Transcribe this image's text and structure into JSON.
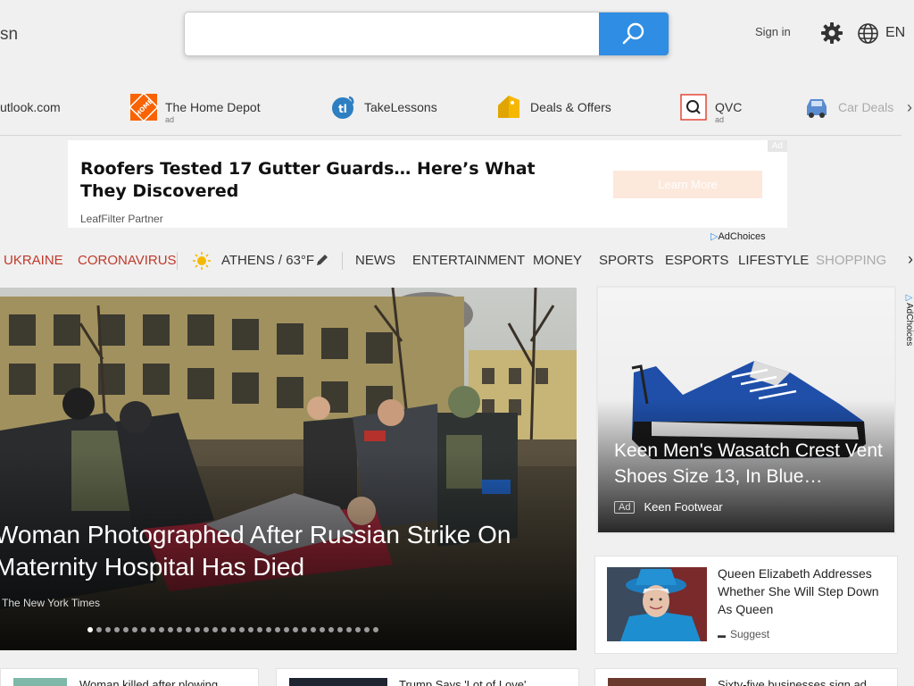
{
  "header": {
    "logo": "sn",
    "search_placeholder": "",
    "sign_in": "Sign in",
    "language": "EN"
  },
  "quicklinks": {
    "items": [
      {
        "label": "utlook.com",
        "ad": ""
      },
      {
        "label": "The Home Depot",
        "ad": "ad"
      },
      {
        "label": "TakeLessons",
        "ad": ""
      },
      {
        "label": "Deals & Offers",
        "ad": ""
      },
      {
        "label": "QVC",
        "ad": "ad"
      },
      {
        "label": "Car Deals",
        "ad": ""
      }
    ]
  },
  "banner": {
    "headline": "Roofers Tested 17 Gutter Guards… Here’s What They Discovered",
    "sponsor": "LeafFilter Partner",
    "cta": "Learn More",
    "ad_tag": "Ad",
    "adchoices": "AdChoices"
  },
  "nav": {
    "ukraine": "UKRAINE",
    "coronavirus": "CORONAVIRUS",
    "weather": "ATHENS / 63°F",
    "items": [
      "NEWS",
      "ENTERTAINMENT",
      "MONEY",
      "SPORTS",
      "ESPORTS",
      "LIFESTYLE",
      "SHOPPING"
    ]
  },
  "hero": {
    "title": "Woman Photographed After Russian Strike On Maternity Hospital Has Died",
    "source": "The New York Times",
    "slide_count": 33,
    "active_slide": 1
  },
  "ad_card": {
    "title": "Keen Men's Wasatch Crest Vent Shoes Size 13, In Blue…",
    "badge": "Ad",
    "brand": "Keen Footwear",
    "adchoices": "AdChoices"
  },
  "queen_card": {
    "title": "Queen Elizabeth Addresses Whether She Will Step Down As Queen",
    "source": "Suggest"
  },
  "bottom_row": {
    "items": [
      {
        "text": "Woman killed after plowing"
      },
      {
        "text": "Trump Says 'Lot of Love'"
      },
      {
        "text": "Sixty-five businesses sign ad"
      }
    ]
  },
  "colors": {
    "accent_blue": "#2f8de4",
    "nav_red": "#c0392b",
    "background": "#f0f0f0"
  }
}
